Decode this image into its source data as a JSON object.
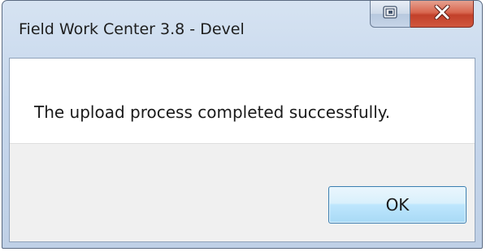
{
  "window": {
    "title": "Field Work Center 3.8 - Devel"
  },
  "titlebar_buttons": {
    "restore_icon": "restore-icon",
    "close_icon": "close-icon"
  },
  "dialog": {
    "message": "The upload process completed successfully.",
    "ok_label": "OK"
  },
  "colors": {
    "close_button": "#d0573e",
    "ok_button_border": "#3c7fb1",
    "titlebar": "#c6d7ec",
    "button_area": "#f0f0f0"
  }
}
